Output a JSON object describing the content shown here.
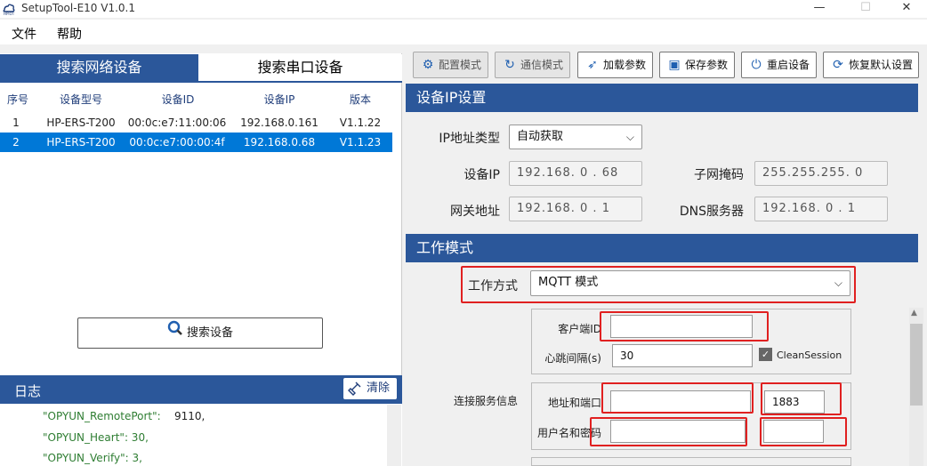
{
  "window": {
    "title": "SetupTool-E10 V1.0.1",
    "minimize": "—",
    "maximize": "☐",
    "close": "✕"
  },
  "menu": [
    "文件",
    "帮助"
  ],
  "left": {
    "tabs": [
      "搜索网络设备",
      "搜索串口设备"
    ],
    "columns": [
      "序号",
      "设备型号",
      "设备ID",
      "设备IP",
      "版本"
    ],
    "rows": [
      [
        "1",
        "HP-ERS-T200",
        "00:0c:e7:11:00:06",
        "192.168.0.161",
        "V1.1.22"
      ],
      [
        "2",
        "HP-ERS-T200",
        "00:0c:e7:00:00:4f",
        "192.168.0.68",
        "V1.1.23"
      ]
    ],
    "selected_row": 2,
    "search_button": "搜索设备",
    "log_title": "日志",
    "clear_button": "清除",
    "log_lines": [
      {
        "key": "\"OPYUN_RemotePort\":",
        "val": "9110,"
      },
      {
        "key": "\"OPYUN_Heart\": 30,",
        "val": ""
      },
      {
        "key": "\"OPYUN_Verify\": 3,",
        "val": ""
      }
    ]
  },
  "toolbar": {
    "config_mode": "配置模式",
    "comm_mode": "通信模式",
    "load_params": "加载参数",
    "save_params": "保存参数",
    "restart": "重启设备",
    "restore": "恢复默认设置"
  },
  "ip_section": {
    "title": "设备IP设置",
    "ip_type_label": "IP地址类型",
    "ip_type_value": "自动获取",
    "device_ip_label": "设备IP",
    "device_ip": "192.168. 0 . 68",
    "subnet_label": "子网掩码",
    "subnet": "255.255.255. 0",
    "gateway_label": "网关地址",
    "gateway": "192.168. 0 . 1",
    "dns_label": "DNS服务器",
    "dns": "192.168. 0 . 1"
  },
  "work_section": {
    "title": "工作模式",
    "mode_label": "工作方式",
    "mode_value": "MQTT 模式",
    "client_id_label": "客户端ID",
    "client_id": "",
    "heartbeat_label": "心跳间隔(s)",
    "heartbeat": "30",
    "clean_session_label": "CleanSession",
    "clean_session": true,
    "server_info_label": "连接服务信息",
    "addr_port_label": "地址和端口",
    "address": "",
    "port": "1883",
    "user_pass_label": "用户名和密码",
    "username": "",
    "password": ""
  },
  "colors": {
    "accent": "#2b579a",
    "selection": "#0078d7",
    "highlight_box": "#e02020",
    "log_key": "#2e7d32"
  }
}
